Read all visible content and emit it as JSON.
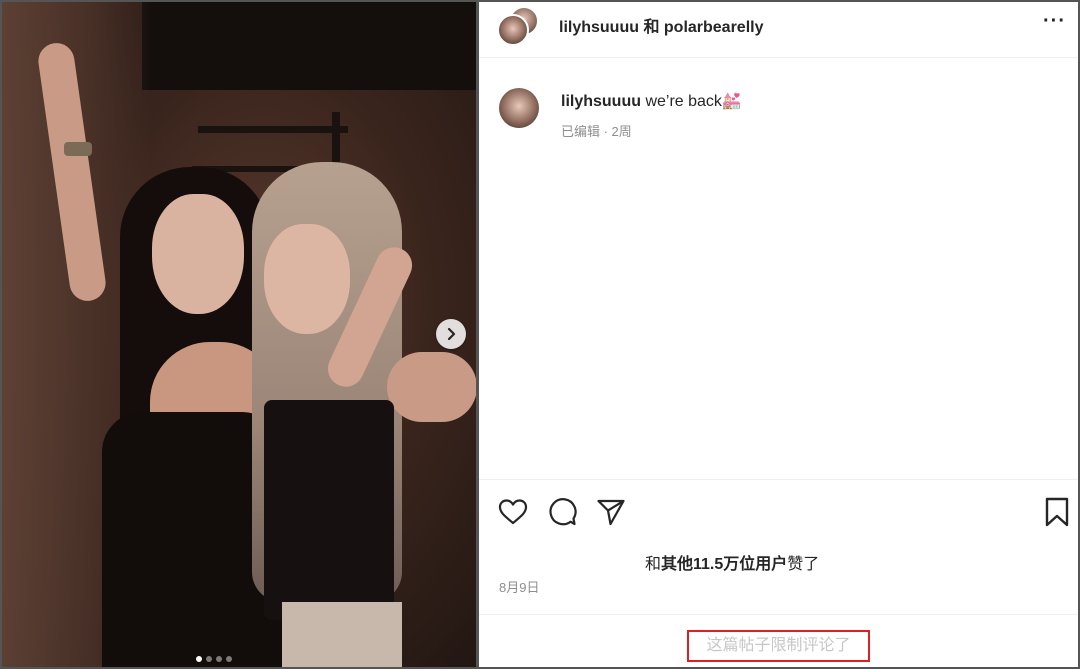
{
  "header": {
    "title": "lilyhsuuuu 和 polarbearelly",
    "more_label": "···"
  },
  "caption": {
    "username": "lilyhsuuuu",
    "text": " we’re back💒",
    "meta": "已编辑 · 2周"
  },
  "media": {
    "slide_count": 4,
    "active_slide": 1
  },
  "likes": {
    "prefix": "和",
    "bold": "其他11.5万位用户",
    "suffix": "赞了"
  },
  "post_date": "8月9日",
  "comments_limited": "这篇帖子限制评论了",
  "icons": {
    "like": "heart-icon",
    "comment": "comment-icon",
    "share": "share-icon",
    "save": "bookmark-icon",
    "next": "chevron-right-icon"
  },
  "colors": {
    "text": "#262626",
    "muted": "#8e8e8e",
    "highlight_border": "#e02020",
    "divider": "#efefef"
  }
}
